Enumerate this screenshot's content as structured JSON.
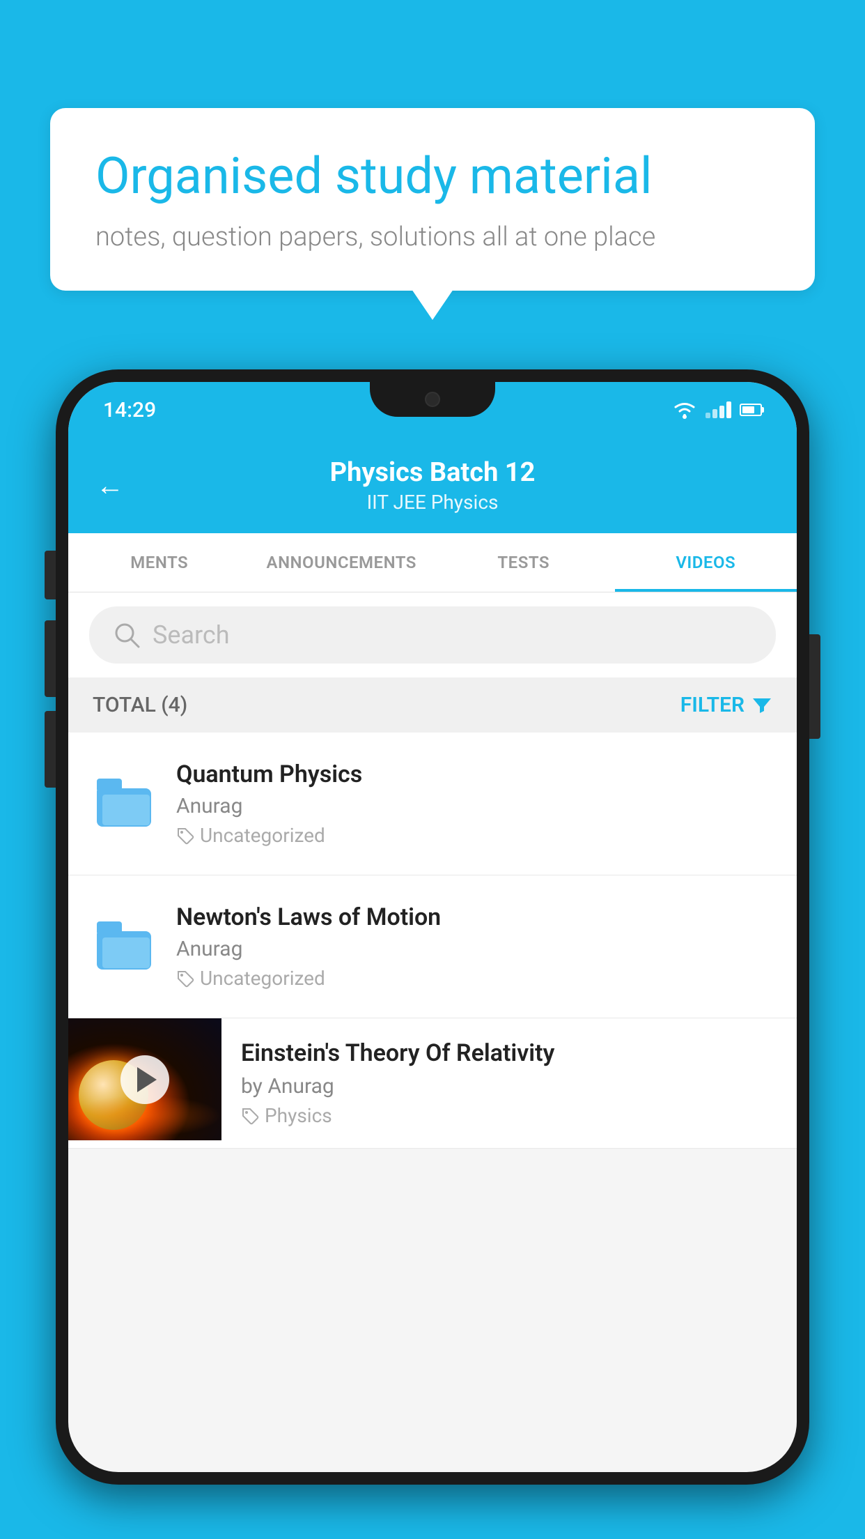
{
  "background_color": "#1ab8e8",
  "speech_bubble": {
    "title": "Organised study material",
    "subtitle": "notes, question papers, solutions all at one place"
  },
  "status_bar": {
    "time": "14:29"
  },
  "app_header": {
    "title": "Physics Batch 12",
    "subtitle": "IIT JEE   Physics",
    "back_label": "←"
  },
  "tabs": [
    {
      "label": "MENTS",
      "active": false
    },
    {
      "label": "ANNOUNCEMENTS",
      "active": false
    },
    {
      "label": "TESTS",
      "active": false
    },
    {
      "label": "VIDEOS",
      "active": true
    }
  ],
  "search": {
    "placeholder": "Search"
  },
  "filter_bar": {
    "total_label": "TOTAL (4)",
    "filter_label": "FILTER"
  },
  "list_items": [
    {
      "title": "Quantum Physics",
      "author": "Anurag",
      "tag": "Uncategorized",
      "type": "folder"
    },
    {
      "title": "Newton's Laws of Motion",
      "author": "Anurag",
      "tag": "Uncategorized",
      "type": "folder"
    }
  ],
  "video_item": {
    "title": "Einstein's Theory Of Relativity",
    "author": "by Anurag",
    "tag": "Physics"
  }
}
